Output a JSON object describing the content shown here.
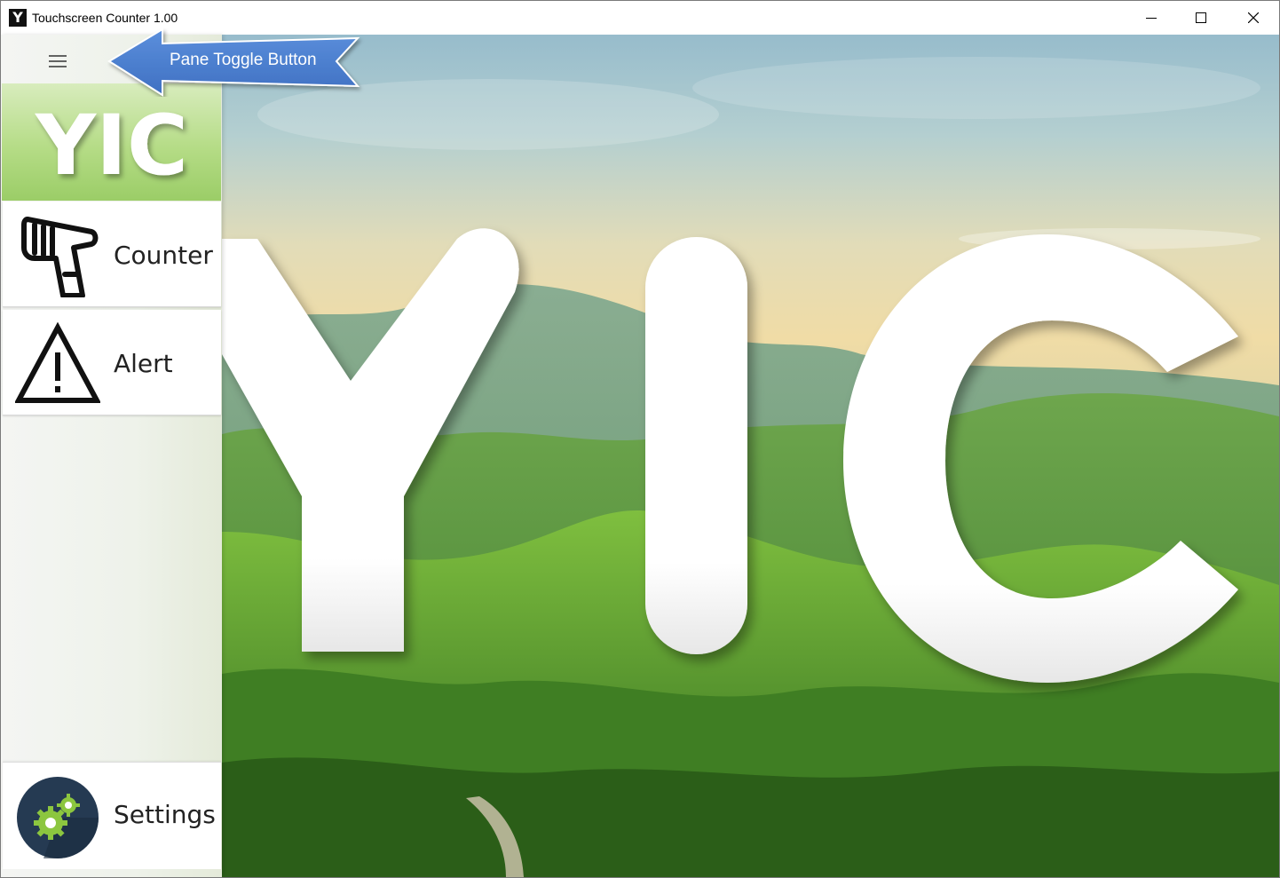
{
  "window": {
    "app_icon_letter": "Y",
    "title": "Touchscreen Counter 1.00"
  },
  "pane": {
    "logo_text": "YIC",
    "nav_items": [
      {
        "label": "Counter",
        "icon": "barcode-scanner-icon"
      },
      {
        "label": "Alert",
        "icon": "warning-triangle-icon"
      }
    ],
    "settings_label": "Settings"
  },
  "background": {
    "big_text": "YIC"
  },
  "annotation": {
    "callout_text": "Pane Toggle Button"
  },
  "colors": {
    "accent_green": "#8cc63f",
    "callout_blue": "#4a7fd0"
  }
}
